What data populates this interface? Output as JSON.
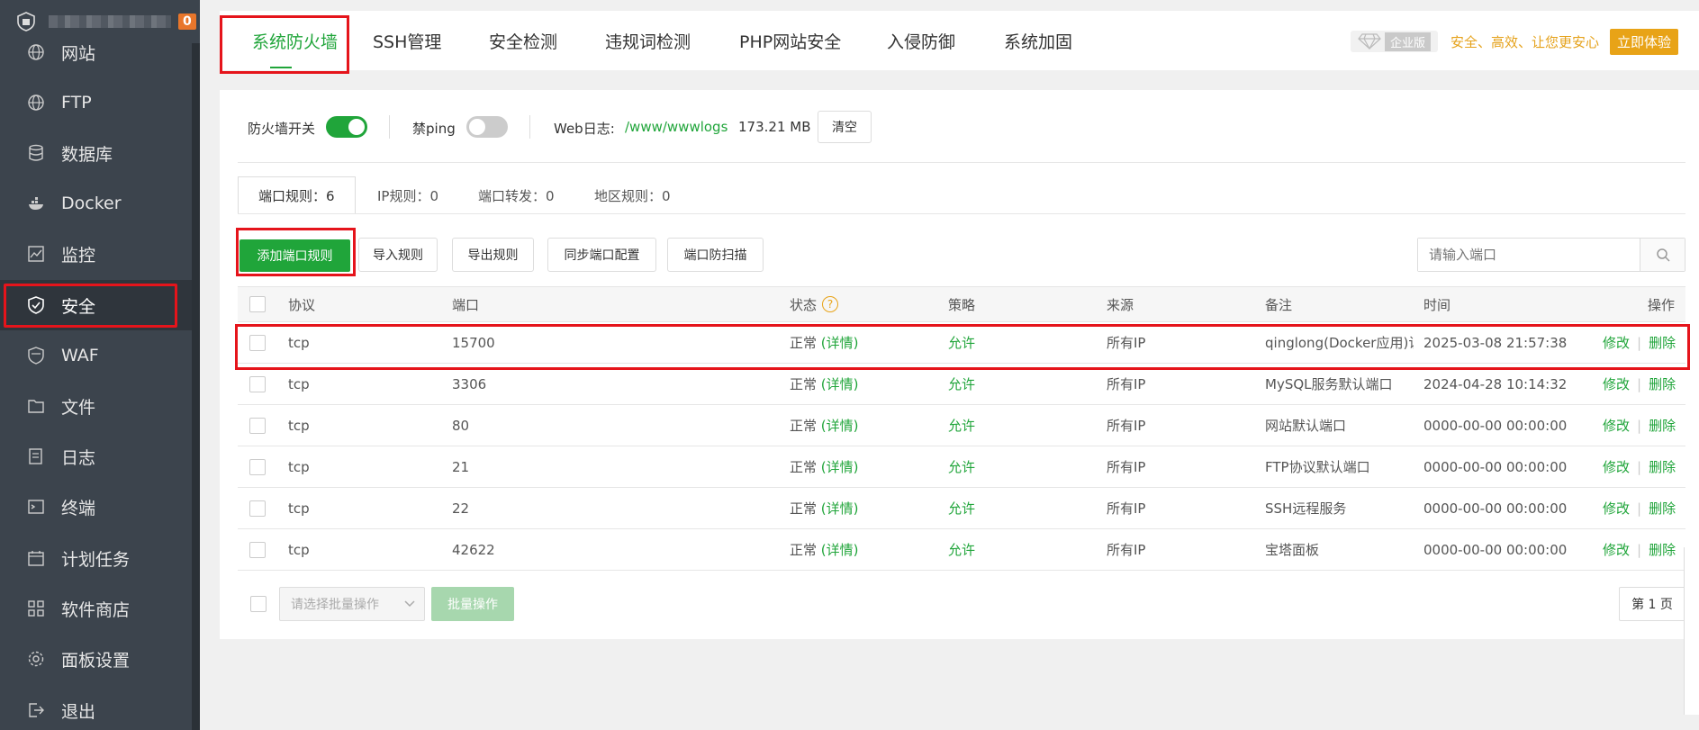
{
  "sidebar": {
    "badge": "0",
    "items": [
      {
        "label": "网站",
        "icon": "globe-icon"
      },
      {
        "label": "FTP",
        "icon": "globe-icon"
      },
      {
        "label": "数据库",
        "icon": "database-icon"
      },
      {
        "label": "Docker",
        "icon": "docker-icon"
      },
      {
        "label": "监控",
        "icon": "monitor-icon"
      },
      {
        "label": "安全",
        "icon": "shield-icon"
      },
      {
        "label": "WAF",
        "icon": "waf-shield-icon"
      },
      {
        "label": "文件",
        "icon": "folder-icon"
      },
      {
        "label": "日志",
        "icon": "log-icon"
      },
      {
        "label": "终端",
        "icon": "terminal-icon"
      },
      {
        "label": "计划任务",
        "icon": "calendar-icon"
      },
      {
        "label": "软件商店",
        "icon": "grid-icon"
      },
      {
        "label": "面板设置",
        "icon": "gear-icon"
      },
      {
        "label": "退出",
        "icon": "logout-icon"
      }
    ]
  },
  "tabs": [
    "系统防火墙",
    "SSH管理",
    "安全检测",
    "违规词检测",
    "PHP网站安全",
    "入侵防御",
    "系统加固"
  ],
  "enterprise": {
    "tag": "企业版",
    "slogan": "安全、高效、让您更安心",
    "button": "立即体验"
  },
  "firewall": {
    "switch_label": "防火墙开关",
    "switch_on": true,
    "ping_label": "禁ping",
    "ping_on": false,
    "weblog_label": "Web日志:",
    "weblog_path": "/www/wwwlogs",
    "weblog_size": "173.21 MB",
    "clear_button": "清空"
  },
  "subtabs": [
    "端口规则：6",
    "IP规则：0",
    "端口转发：0",
    "地区规则：0"
  ],
  "actions": {
    "add": "添加端口规则",
    "import": "导入规则",
    "export": "导出规则",
    "sync": "同步端口配置",
    "scan": "端口防扫描",
    "search_placeholder": "请输入端口"
  },
  "table": {
    "headers": {
      "protocol": "协议",
      "port": "端口",
      "status": "状态",
      "policy": "策略",
      "source": "来源",
      "remark": "备注",
      "time": "时间",
      "ops": "操作"
    },
    "detail_label": "(详情)",
    "edit_label": "修改",
    "delete_label": "删除",
    "rows": [
      {
        "protocol": "tcp",
        "port": "15700",
        "status": "正常",
        "policy": "允许",
        "source": "所有IP",
        "remark": "qinglong(Docker应用)访",
        "time": "2025-03-08 21:57:38"
      },
      {
        "protocol": "tcp",
        "port": "3306",
        "status": "正常",
        "policy": "允许",
        "source": "所有IP",
        "remark": "MySQL服务默认端口",
        "time": "2024-04-28 10:14:32"
      },
      {
        "protocol": "tcp",
        "port": "80",
        "status": "正常",
        "policy": "允许",
        "source": "所有IP",
        "remark": "网站默认端口",
        "time": "0000-00-00 00:00:00"
      },
      {
        "protocol": "tcp",
        "port": "21",
        "status": "正常",
        "policy": "允许",
        "source": "所有IP",
        "remark": "FTP协议默认端口",
        "time": "0000-00-00 00:00:00"
      },
      {
        "protocol": "tcp",
        "port": "22",
        "status": "正常",
        "policy": "允许",
        "source": "所有IP",
        "remark": "SSH远程服务",
        "time": "0000-00-00 00:00:00"
      },
      {
        "protocol": "tcp",
        "port": "42622",
        "status": "正常",
        "policy": "允许",
        "source": "所有IP",
        "remark": "宝塔面板",
        "time": "0000-00-00 00:00:00"
      }
    ]
  },
  "footer": {
    "bulk_placeholder": "请选择批量操作",
    "bulk_button": "批量操作",
    "page": "第 1 页"
  },
  "colors": {
    "accent": "#20a53a",
    "highlight": "#e5141b",
    "sidebar": "#3c444d",
    "gold": "#e8a317"
  }
}
